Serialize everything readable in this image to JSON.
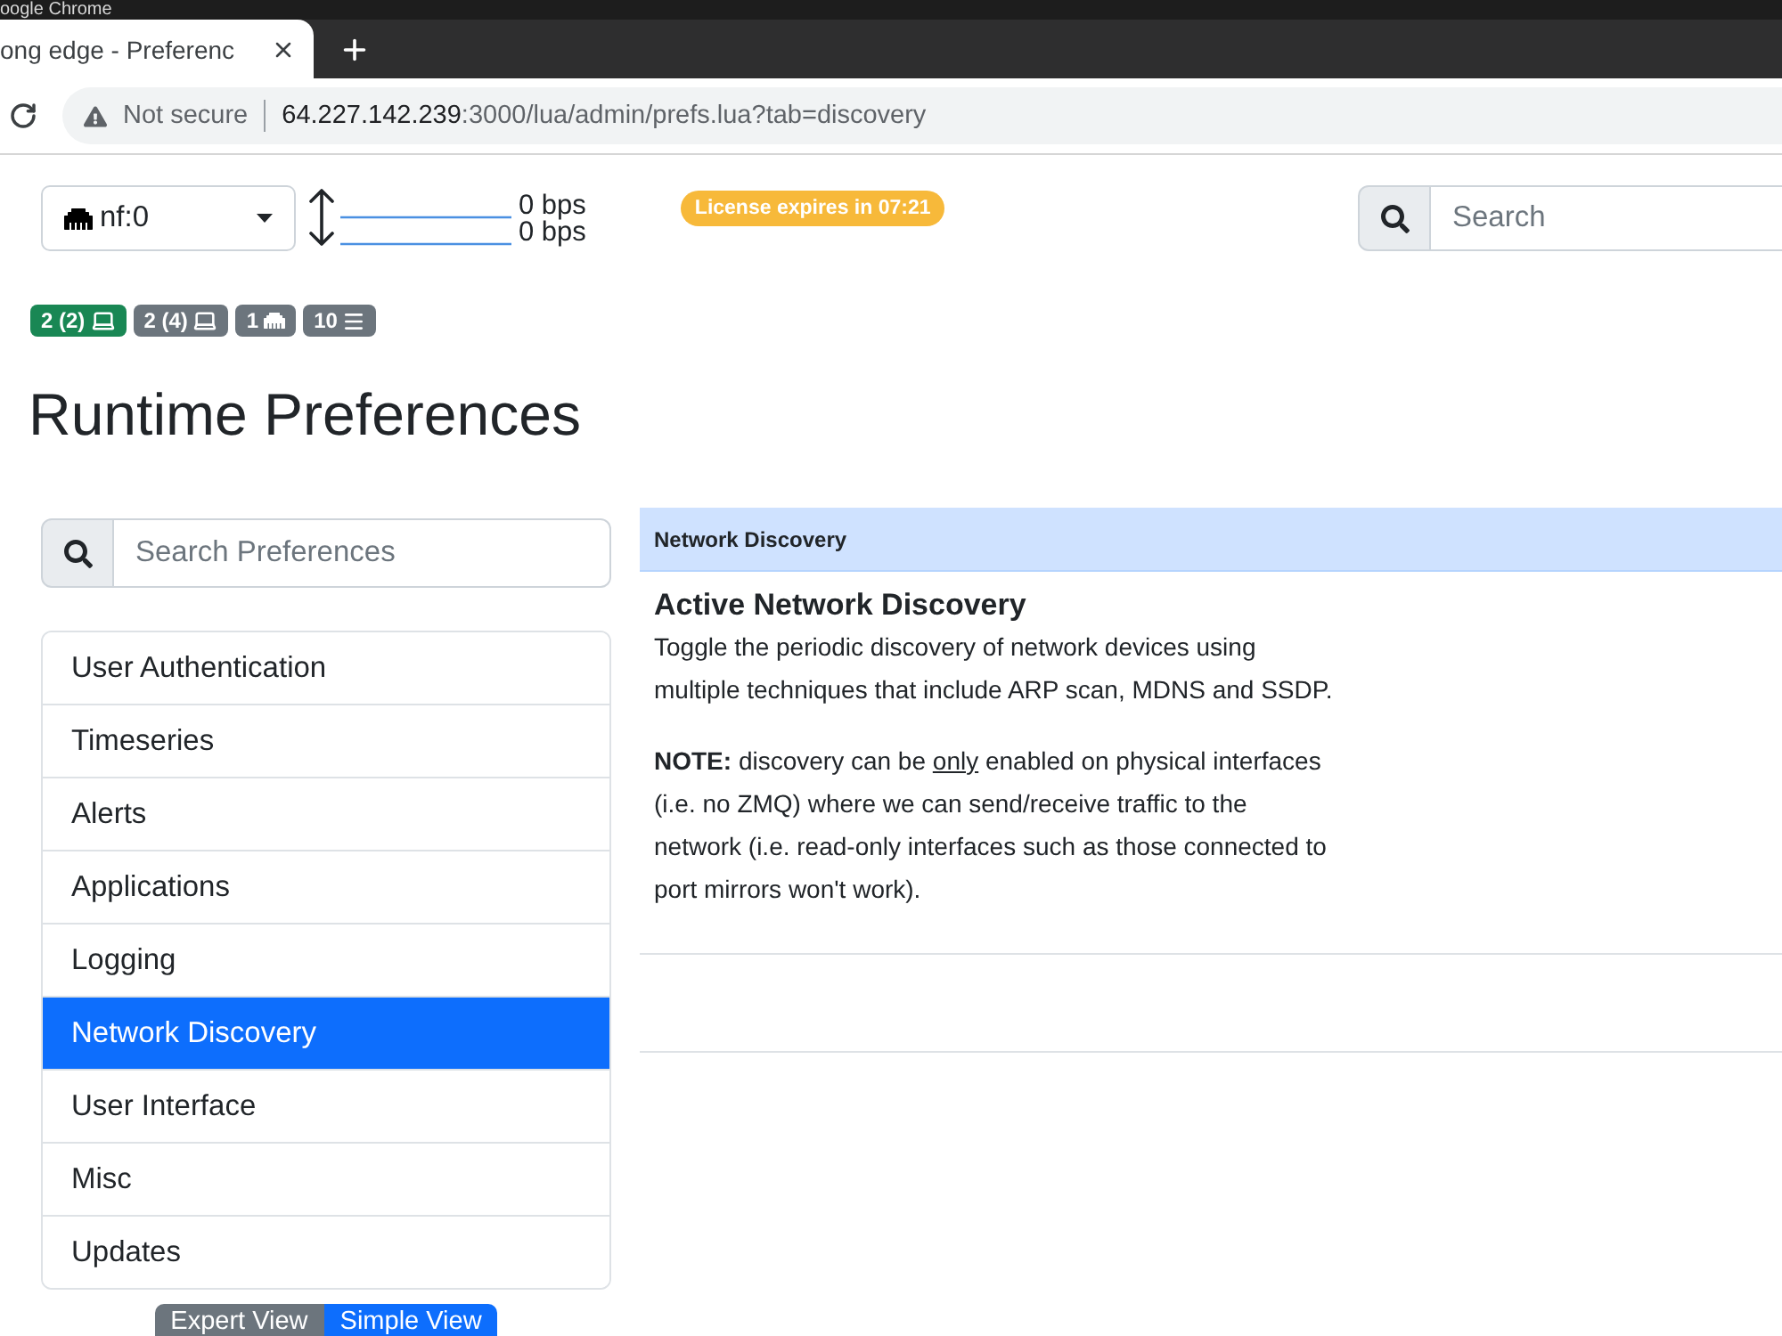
{
  "window": {
    "title": "oogle Chrome"
  },
  "browser": {
    "tabs": [
      {
        "title": "ong edge - Preferenc",
        "selected": true
      }
    ],
    "security": "Not secure",
    "url_host": "64.227.142.239",
    "url_path": ":3000/lua/admin/prefs.lua?tab=discovery"
  },
  "header": {
    "interface": "nf:0",
    "upload_rate": "0 bps",
    "download_rate": "0 bps",
    "license_badge": "License expires in 07:21",
    "search": {
      "placeholder": "Search"
    }
  },
  "status_badges": [
    {
      "label": "2 (2)",
      "kind": "host",
      "color": "#198754"
    },
    {
      "label": "2 (4)",
      "kind": "host",
      "color": "#6c757d"
    },
    {
      "label": "1",
      "kind": "device",
      "color": "#6c757d"
    },
    {
      "label": "10",
      "kind": "flow",
      "color": "#6c757d"
    }
  ],
  "page_title": "Runtime Preferences",
  "sidebar": {
    "search": {
      "placeholder": "Search Preferences"
    },
    "items": [
      {
        "label": "User Authentication",
        "selected": false
      },
      {
        "label": "Timeseries",
        "selected": false
      },
      {
        "label": "Alerts",
        "selected": false
      },
      {
        "label": "Applications",
        "selected": false
      },
      {
        "label": "Logging",
        "selected": false
      },
      {
        "label": "Network Discovery",
        "selected": true
      },
      {
        "label": "User Interface",
        "selected": false
      },
      {
        "label": "Misc",
        "selected": false
      },
      {
        "label": "Updates",
        "selected": false
      }
    ],
    "view_buttons": [
      {
        "label": "Expert View",
        "selected": false
      },
      {
        "label": "Simple View",
        "selected": true
      }
    ]
  },
  "panel": {
    "header": "Network Discovery",
    "rows": [
      {
        "title": "Active Network Discovery",
        "description": "Toggle the periodic discovery of network devices using multiple techniques that include ARP scan, MDNS and SSDP.",
        "note": {
          "lead": "NOTE:",
          "before": "discovery can be",
          "underlined": "only",
          "after": "enabled on physical interfaces (i.e. no ZMQ) where we can send/receive traffic to the network (i.e. read-only interfaces such as those connected to port mirrors won't work)."
        }
      }
    ]
  }
}
